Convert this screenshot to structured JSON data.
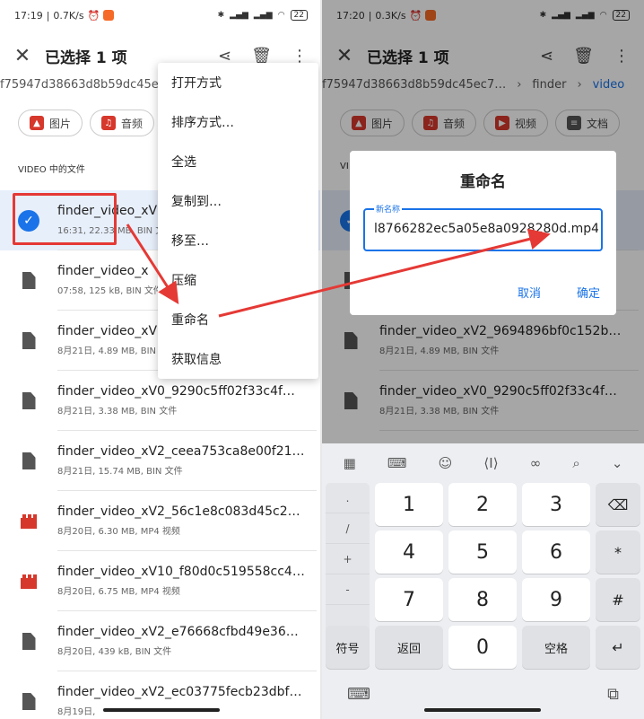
{
  "left": {
    "status": {
      "time": "17:19",
      "speed": "0.7K/s",
      "battery": "22"
    },
    "title": "已选择 1 项",
    "path": {
      "hash": "f75947d38663d8b59dc45ec"
    },
    "chips": [
      {
        "icon": "image-icon",
        "label": "图片"
      },
      {
        "icon": "music-icon",
        "label": "音频"
      }
    ],
    "section": "VIDEO 中的文件",
    "rows": [
      {
        "name": "finder_video_xV",
        "meta": "16:31, 22.33 MB, BIN 文",
        "type": "selected"
      },
      {
        "name": "finder_video_x",
        "meta": "07:58, 125 kB, BIN 文件",
        "type": "file"
      },
      {
        "name": "finder_video_xV",
        "meta": "8月21日, 4.89 MB, BIN",
        "type": "file"
      },
      {
        "name": "finder_video_xV0_9290c5ff02f33c4f…",
        "meta": "8月21日, 3.38 MB, BIN 文件",
        "type": "file"
      },
      {
        "name": "finder_video_xV2_ceea753ca8e00f21…",
        "meta": "8月21日, 15.74 MB, BIN 文件",
        "type": "file"
      },
      {
        "name": "finder_video_xV2_56c1e8c083d45c2…",
        "meta": "8月20日, 6.30 MB, MP4 视频",
        "type": "video"
      },
      {
        "name": "finder_video_xV10_f80d0c519558cc4…",
        "meta": "8月20日, 6.75 MB, MP4 视频",
        "type": "video"
      },
      {
        "name": "finder_video_xV2_e76668cfbd49e36…",
        "meta": "8月20日, 439 kB, BIN 文件",
        "type": "file"
      },
      {
        "name": "finder_video_xV2_ec03775fecb23dbf…",
        "meta": "8月19日,",
        "type": "file"
      }
    ],
    "menu": [
      "打开方式",
      "排序方式…",
      "全选",
      "复制到…",
      "移至…",
      "压缩",
      "重命名",
      "获取信息"
    ]
  },
  "right": {
    "status": {
      "time": "17:20",
      "speed": "0.3K/s",
      "battery": "22"
    },
    "title": "已选择 1 项",
    "path": {
      "hash": "f75947d38663d8b59dc45ec7…",
      "folder1": "finder",
      "folder2": "video"
    },
    "chips": [
      {
        "icon": "image-icon",
        "label": "图片"
      },
      {
        "icon": "music-icon",
        "label": "音频"
      },
      {
        "icon": "video-icon",
        "label": "视频"
      },
      {
        "icon": "document-icon",
        "label": "文档"
      }
    ],
    "section": "VI",
    "rows": [
      {
        "name": "",
        "meta": "",
        "type": "selected"
      },
      {
        "name": "",
        "meta": "",
        "type": "file"
      },
      {
        "name": "finder_video_xV2_9694896bf0c152b…",
        "meta": "8月21日, 4.89 MB, BIN 文件",
        "type": "file"
      },
      {
        "name": "finder_video_xV0_9290c5ff02f33c4f…",
        "meta": "8月21日, 3.38 MB, BIN 文件",
        "type": "file"
      }
    ],
    "dialog": {
      "title": "重命名",
      "label": "新名称",
      "value": "l8766282ec5a05e8a0928280d.mp4",
      "cancel": "取消",
      "ok": "确定"
    },
    "keyboard": {
      "side": [
        ".",
        "/",
        "+",
        "-"
      ],
      "digits": [
        "1",
        "2",
        "3",
        "4",
        "5",
        "6",
        "7",
        "8",
        "9",
        "0"
      ],
      "sym": [
        "*",
        "#"
      ],
      "mode": "符号",
      "back": "返回",
      "space": "空格"
    }
  },
  "colors": {
    "accent": "#1a73e8",
    "annotation": "#e53935"
  }
}
